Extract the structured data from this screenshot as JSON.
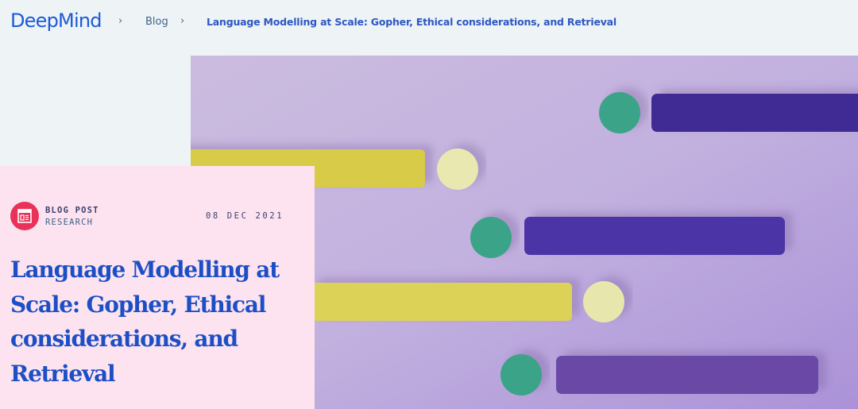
{
  "header": {
    "logo": "DeepMind",
    "breadcrumb": {
      "separator": "›",
      "blog": "Blog",
      "current": "Language Modelling at Scale: Gopher, Ethical considerations, and Retrieval"
    }
  },
  "post": {
    "type": "BLOG POST",
    "category": "RESEARCH",
    "date": "08 DEC 2021",
    "title": "Language Modelling at Scale: Gopher, Ethical considerations, and Retrieval"
  },
  "colors": {
    "accent_blue": "#1c4fc6",
    "card_pink": "#fde3ef",
    "icon_red": "#e8325a",
    "hero_lavender": "#c9b7df",
    "bar_purple": "#4a35a0",
    "bar_yellow": "#ded152",
    "dot_teal": "#3aa388",
    "dot_cream": "#e7e7ad"
  },
  "icons": {
    "post_type": "article-icon"
  }
}
